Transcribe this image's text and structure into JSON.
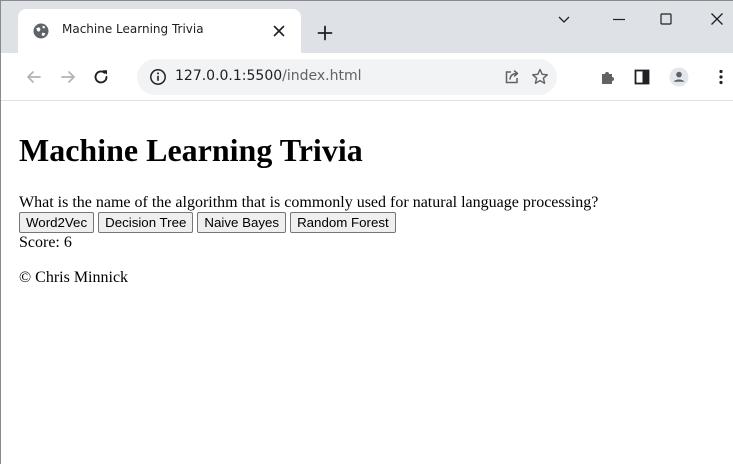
{
  "browser": {
    "tab": {
      "title": "Machine Learning Trivia",
      "favicon": "globe-icon"
    },
    "address_bar": {
      "host": "127.0.0.1:5500",
      "path": "/index.html"
    },
    "icons": {
      "tab_close": "close-icon",
      "new_tab": "plus-icon",
      "window_controls": [
        "chevron-down-icon",
        "minimize-icon",
        "maximize-icon",
        "close-icon"
      ],
      "navigation": [
        "back-arrow-icon",
        "forward-arrow-icon",
        "reload-icon"
      ],
      "omnibox_info": "info-icon",
      "toolbar_right": [
        "share-icon",
        "star-icon",
        "extensions-icon",
        "side-panel-icon",
        "profile-icon",
        "kebab-menu-icon"
      ]
    },
    "colors": {
      "tabstrip": "#dee1e6",
      "omnibox": "#f1f3f4",
      "icon": "#5f6368"
    }
  },
  "page": {
    "title": "Machine Learning Trivia",
    "question": "What is the name of the algorithm that is commonly used for natural language processing?",
    "answers": [
      {
        "label": "Word2Vec"
      },
      {
        "label": "Decision Tree"
      },
      {
        "label": "Naive Bayes"
      },
      {
        "label": "Random Forest"
      }
    ],
    "score": "Score: 6",
    "footer": "© Chris Minnick"
  }
}
